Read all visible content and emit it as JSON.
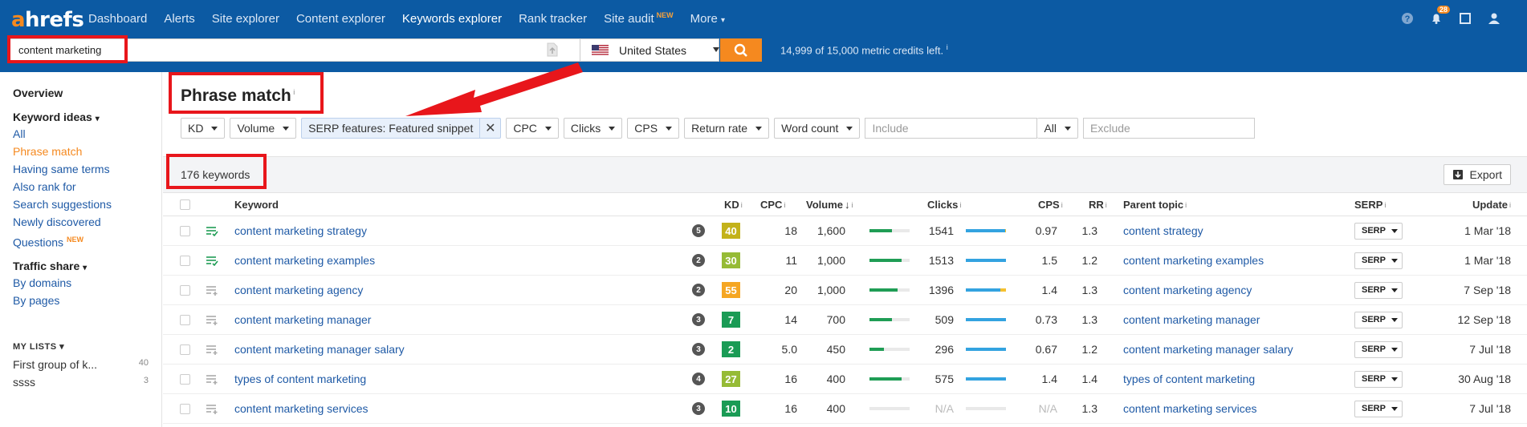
{
  "brand": {
    "logo_a": "a",
    "logo_rest": "hrefs"
  },
  "nav": {
    "items": [
      "Dashboard",
      "Alerts",
      "Site explorer",
      "Content explorer",
      "Keywords explorer",
      "Rank tracker",
      "Site audit",
      "More"
    ],
    "site_audit_badge": "NEW",
    "notification_count": "28"
  },
  "search": {
    "value": "content marketing",
    "country": "United States",
    "credits": "14,999 of 15,000 metric credits left."
  },
  "sidebar": {
    "overview": "Overview",
    "keyword_ideas": "Keyword ideas",
    "ideas": [
      "All",
      "Phrase match",
      "Having same terms",
      "Also rank for",
      "Search suggestions",
      "Newly discovered",
      "Questions"
    ],
    "questions_badge": "NEW",
    "traffic_share": "Traffic share",
    "traffic": [
      "By domains",
      "By pages"
    ],
    "my_lists": "MY LISTS",
    "lists": [
      {
        "name": "First group of k...",
        "count": "40"
      },
      {
        "name": "ssss",
        "count": "3"
      }
    ]
  },
  "main": {
    "title": "Phrase match",
    "filters": {
      "kd": "KD",
      "volume": "Volume",
      "serp_features": "SERP features: Featured snippet",
      "cpc": "CPC",
      "clicks": "Clicks",
      "cps": "CPS",
      "return_rate": "Return rate",
      "word_count": "Word count",
      "include_placeholder": "Include",
      "all": "All",
      "exclude_placeholder": "Exclude"
    },
    "keyword_count": "176 keywords",
    "export": "Export"
  },
  "table": {
    "headers": {
      "keyword": "Keyword",
      "kd": "KD",
      "cpc": "CPC",
      "volume": "Volume",
      "clicks": "Clicks",
      "cps": "CPS",
      "rr": "RR",
      "parent_topic": "Parent topic",
      "serp": "SERP",
      "update": "Update"
    },
    "serp_button": "SERP",
    "rows": [
      {
        "keyword": "content marketing strategy",
        "sf": "5",
        "kd": "40",
        "kd_color": "#c3b21a",
        "cpc": "18",
        "volume": "1,600",
        "vol_pct": 0.55,
        "clicks": "1541",
        "clicks_pct": 0.97,
        "paid_pct": 0.03,
        "cps": "0.97",
        "rr": "1.3",
        "parent": "content strategy",
        "update": "1 Mar '18",
        "checked_icon": true
      },
      {
        "keyword": "content marketing examples",
        "sf": "2",
        "kd": "30",
        "kd_color": "#96bb36",
        "cpc": "11",
        "volume": "1,000",
        "vol_pct": 0.8,
        "clicks": "1513",
        "clicks_pct": 1.0,
        "paid_pct": 0,
        "cps": "1.5",
        "rr": "1.2",
        "parent": "content marketing examples",
        "update": "1 Mar '18",
        "checked_icon": true
      },
      {
        "keyword": "content marketing agency",
        "sf": "2",
        "kd": "55",
        "kd_color": "#f5a623",
        "cpc": "20",
        "volume": "1,000",
        "vol_pct": 0.7,
        "clicks": "1396",
        "clicks_pct": 0.85,
        "paid_pct": 0.15,
        "cps": "1.4",
        "rr": "1.3",
        "parent": "content marketing agency",
        "update": "7 Sep '18",
        "checked_icon": false
      },
      {
        "keyword": "content marketing manager",
        "sf": "3",
        "kd": "7",
        "kd_color": "#1a9b55",
        "cpc": "14",
        "volume": "700",
        "vol_pct": 0.55,
        "clicks": "509",
        "clicks_pct": 0.99,
        "paid_pct": 0,
        "cps": "0.73",
        "rr": "1.3",
        "parent": "content marketing manager",
        "update": "12 Sep '18",
        "checked_icon": false
      },
      {
        "keyword": "content marketing manager salary",
        "sf": "3",
        "kd": "2",
        "kd_color": "#1a9b55",
        "cpc": "5.0",
        "volume": "450",
        "vol_pct": 0.35,
        "clicks": "296",
        "clicks_pct": 0.99,
        "paid_pct": 0,
        "cps": "0.67",
        "rr": "1.2",
        "parent": "content marketing manager salary",
        "update": "7 Jul '18",
        "checked_icon": false
      },
      {
        "keyword": "types of content marketing",
        "sf": "4",
        "kd": "27",
        "kd_color": "#96bb36",
        "cpc": "16",
        "volume": "400",
        "vol_pct": 0.8,
        "clicks": "575",
        "clicks_pct": 1.0,
        "paid_pct": 0,
        "cps": "1.4",
        "rr": "1.4",
        "parent": "types of content marketing",
        "update": "30 Aug '18",
        "checked_icon": false
      },
      {
        "keyword": "content marketing services",
        "sf": "3",
        "kd": "10",
        "kd_color": "#1a9b55",
        "cpc": "16",
        "volume": "400",
        "vol_pct": 0,
        "clicks": "N/A",
        "clicks_pct": 0,
        "paid_pct": 0,
        "cps": "N/A",
        "rr": "1.3",
        "parent": "content marketing services",
        "update": "7 Jul '18",
        "checked_icon": false
      }
    ]
  }
}
